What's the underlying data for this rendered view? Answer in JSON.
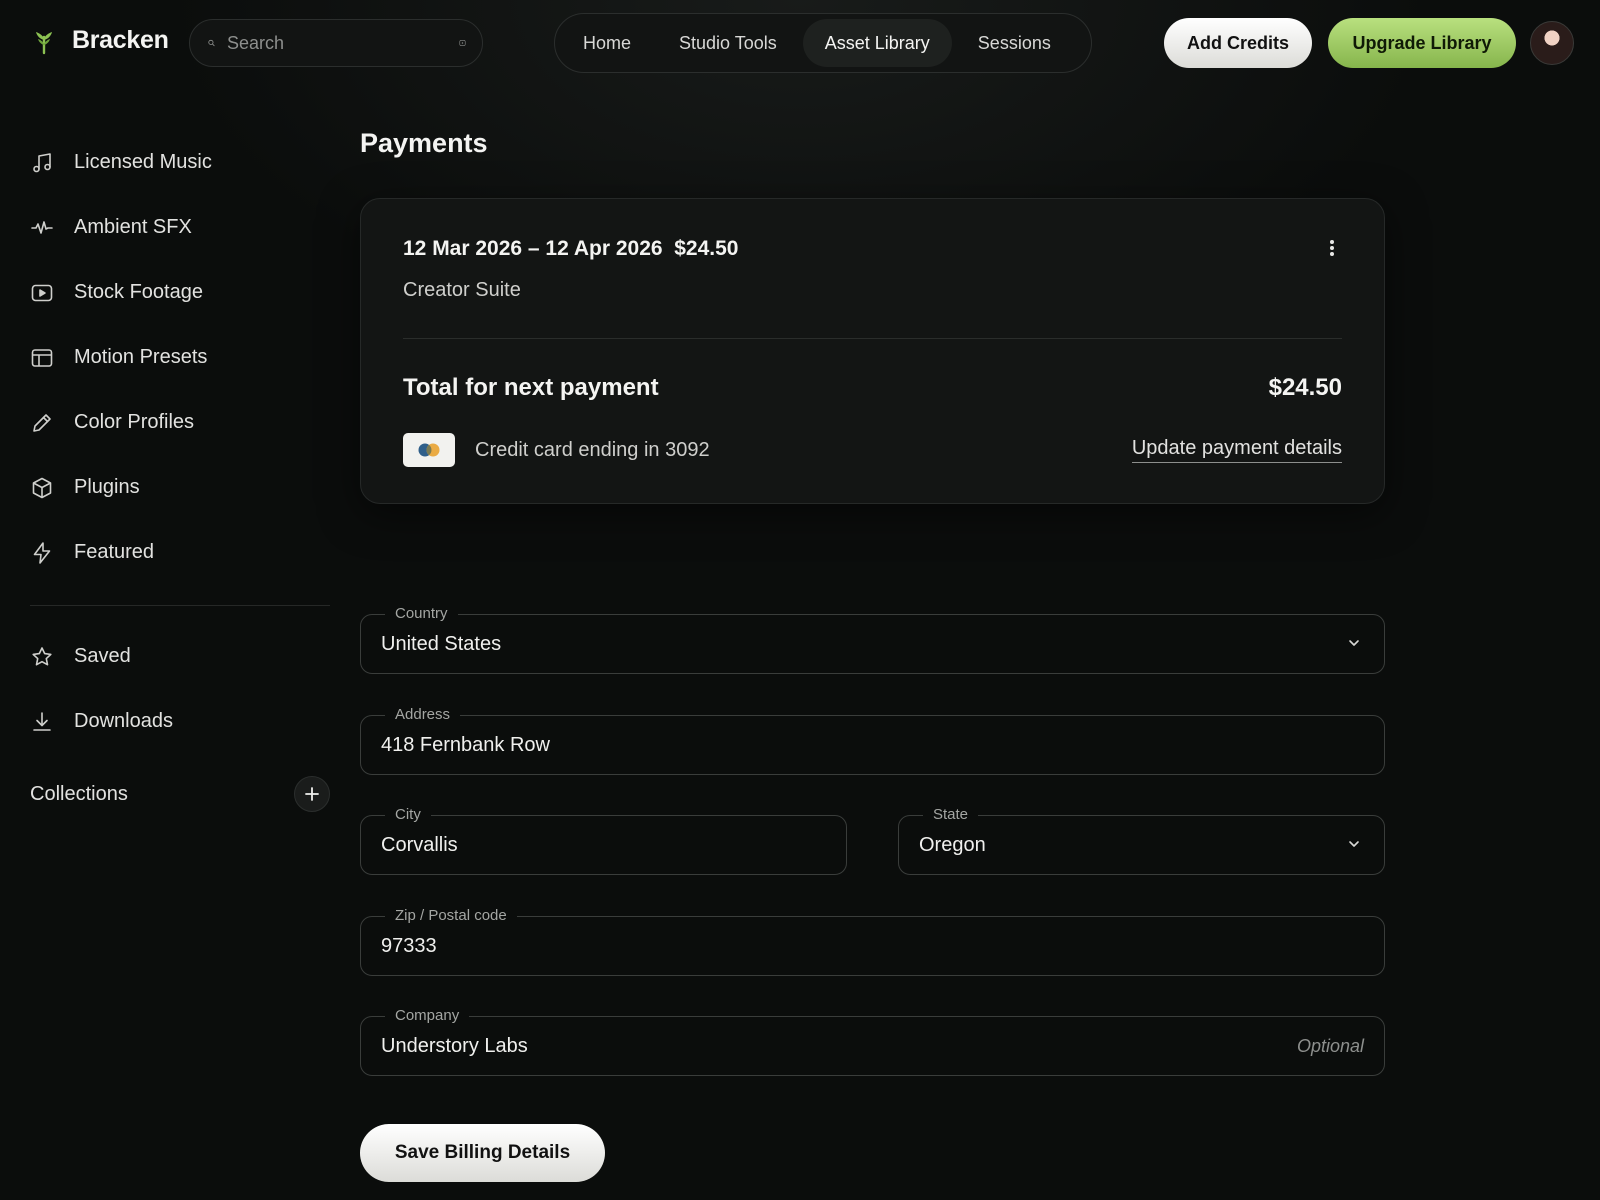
{
  "header": {
    "brand": "Bracken",
    "search_placeholder": "Search",
    "nav": [
      {
        "label": "Home",
        "active": false
      },
      {
        "label": "Studio Tools",
        "active": false
      },
      {
        "label": "Asset Library",
        "active": true
      },
      {
        "label": "Sessions",
        "active": false
      }
    ],
    "add_credits_label": "Add Credits",
    "upgrade_label": "Upgrade Library",
    "accent_color": "#9fcb62"
  },
  "sidebar": {
    "items": [
      {
        "label": "Licensed Music",
        "icon": "music-note-icon"
      },
      {
        "label": "Ambient SFX",
        "icon": "waveform-icon"
      },
      {
        "label": "Stock Footage",
        "icon": "play-square-icon"
      },
      {
        "label": "Motion Presets",
        "icon": "layout-icon"
      },
      {
        "label": "Color Profiles",
        "icon": "pencil-icon"
      },
      {
        "label": "Plugins",
        "icon": "cube-icon"
      },
      {
        "label": "Featured",
        "icon": "lightning-icon"
      }
    ],
    "secondary": [
      {
        "label": "Saved",
        "icon": "star-icon"
      },
      {
        "label": "Downloads",
        "icon": "download-icon"
      }
    ],
    "collections_label": "Collections"
  },
  "main": {
    "title": "Payments",
    "card": {
      "period": "12 Mar 2026 – 12 Apr 2026",
      "amount": "$24.50",
      "plan": "Creator Suite",
      "total_label": "Total for next payment",
      "total_amount": "$24.50",
      "card_text": "Credit card ending in 3092",
      "update_link": "Update payment details"
    },
    "form": {
      "country": {
        "label": "Country",
        "value": "United States"
      },
      "address": {
        "label": "Address",
        "value": "418 Fernbank Row"
      },
      "city": {
        "label": "City",
        "value": "Corvallis"
      },
      "state": {
        "label": "State",
        "value": "Oregon"
      },
      "zip": {
        "label": "Zip / Postal code",
        "value": "97333"
      },
      "company": {
        "label": "Company",
        "value": "Understory Labs",
        "hint": "Optional"
      }
    },
    "save_label": "Save Billing Details"
  }
}
